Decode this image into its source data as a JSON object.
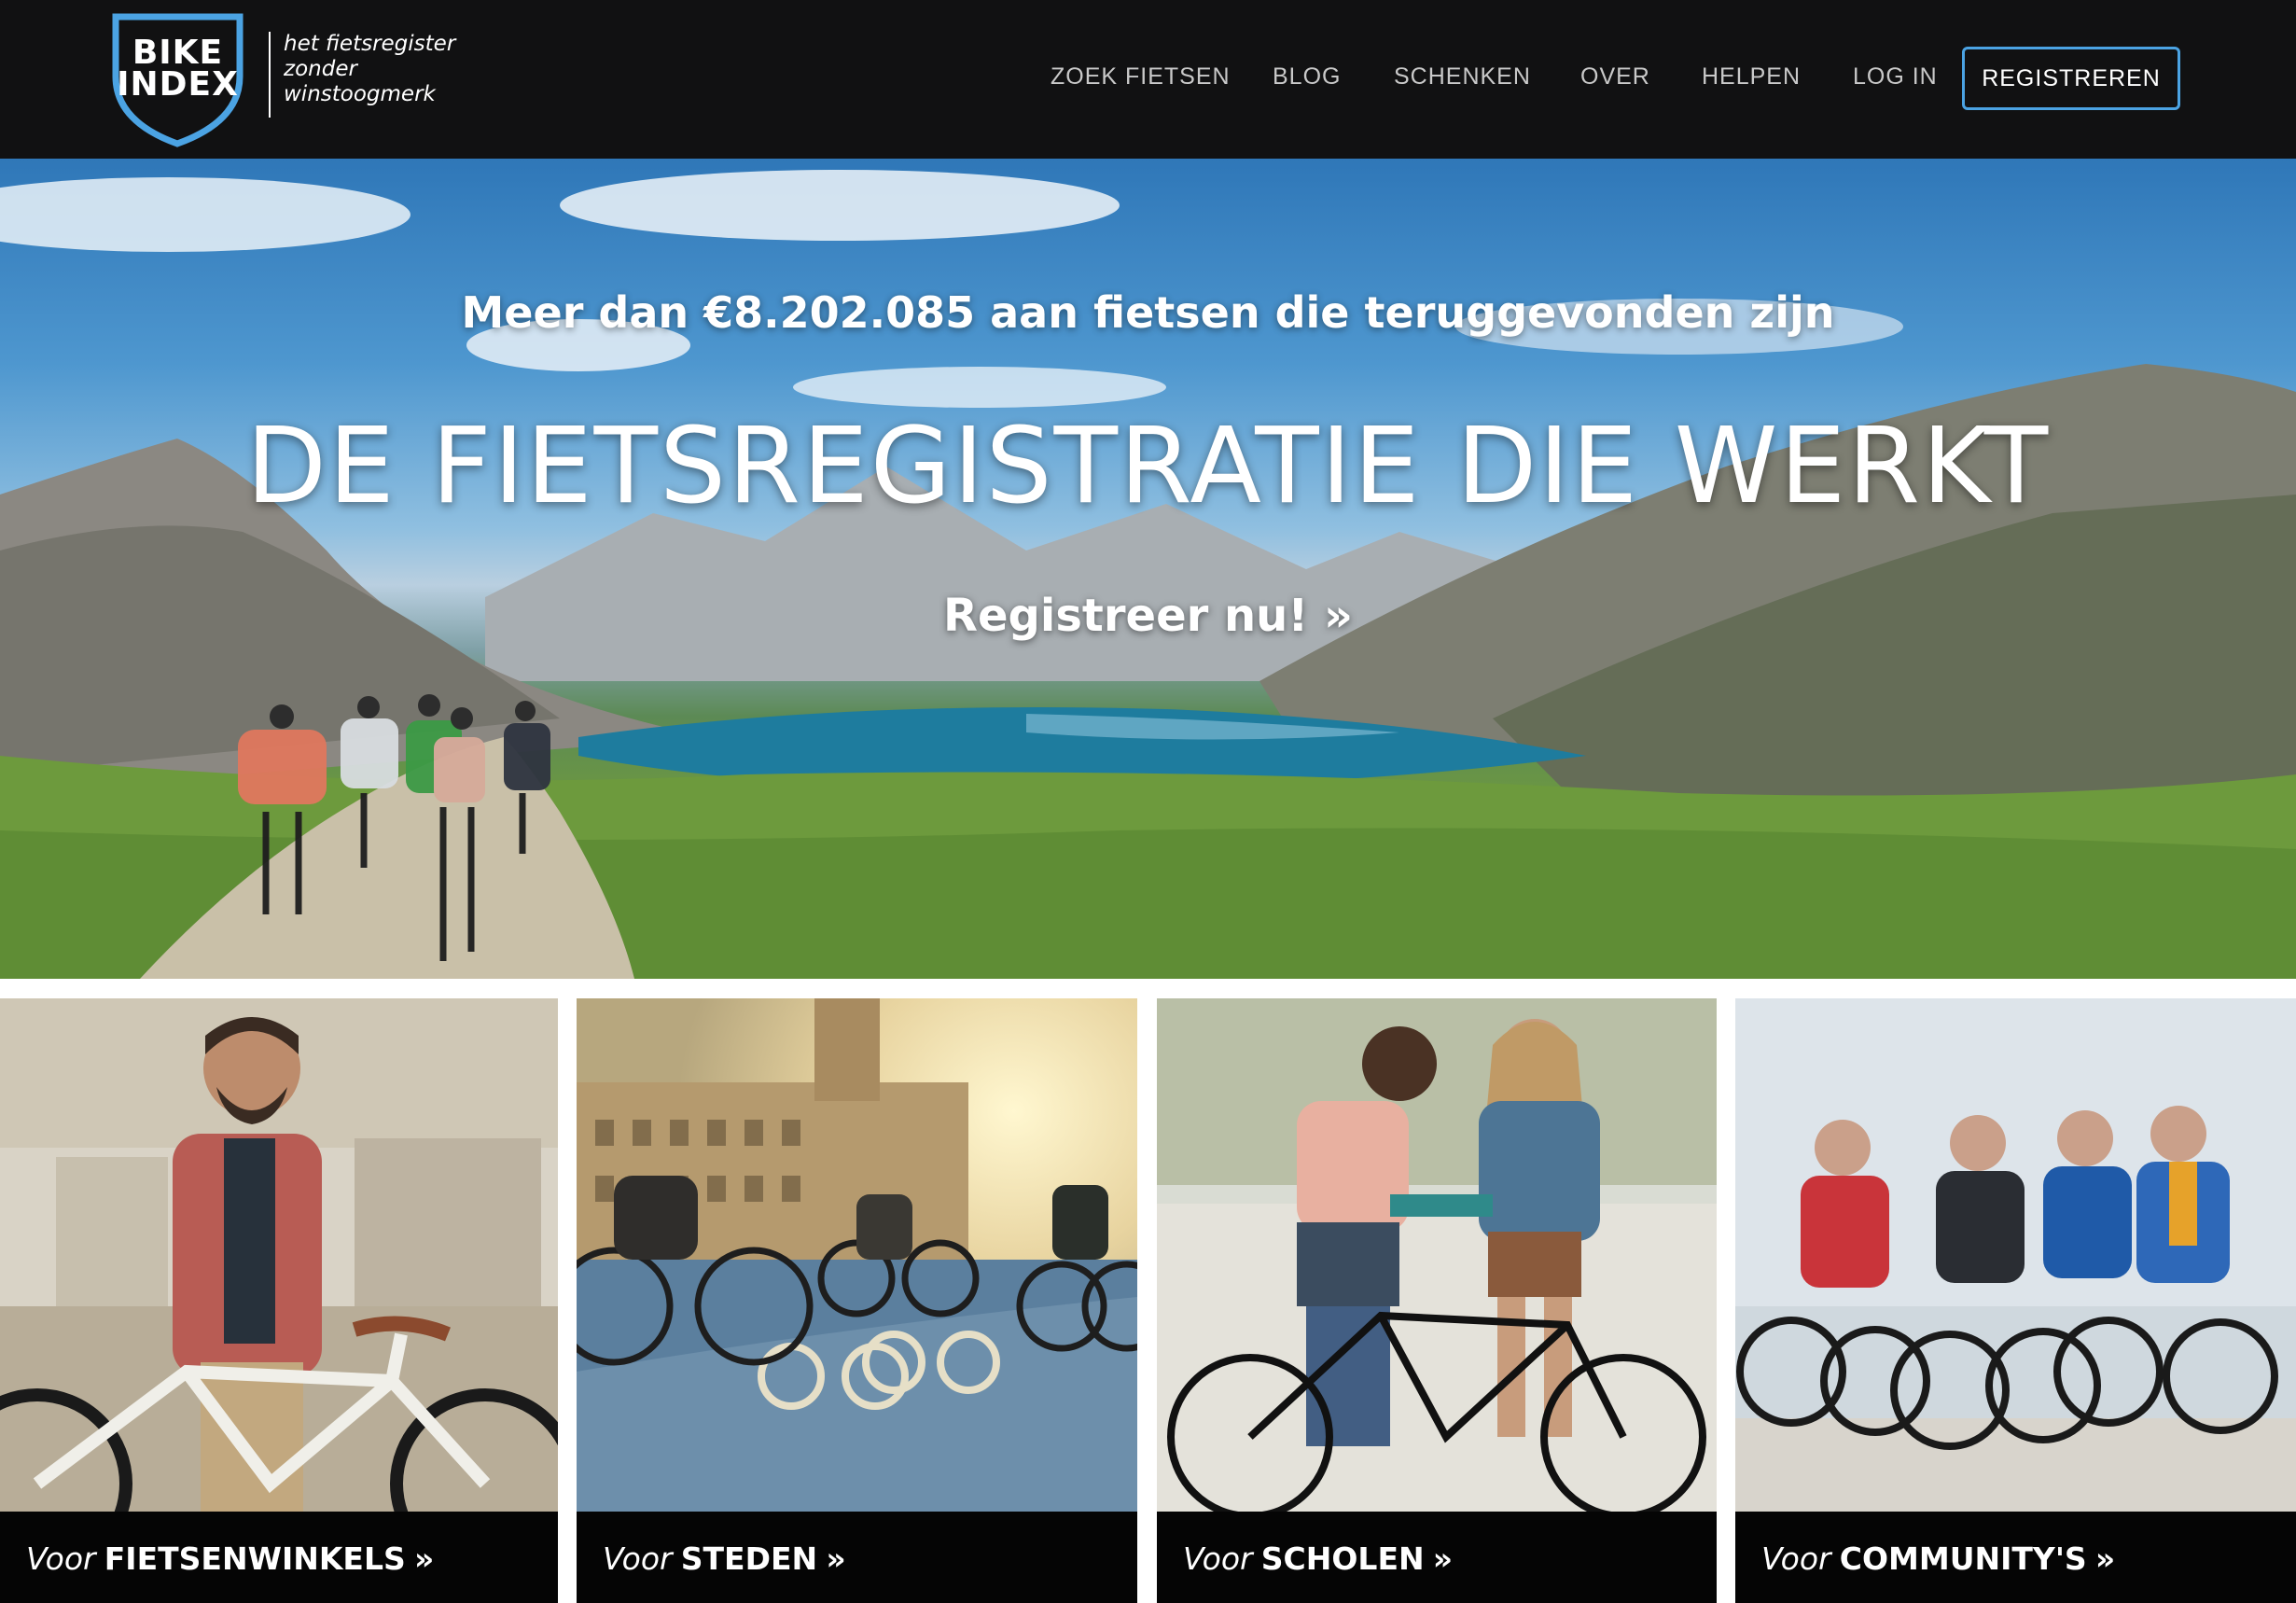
{
  "header": {
    "logo": {
      "line1": "BIKE",
      "line2": "INDEX",
      "tagline": [
        "het fietsregister",
        "zonder",
        "winstoogmerk"
      ]
    },
    "nav": [
      "ZOEK FIETSEN",
      "BLOG",
      "SCHENKEN",
      "OVER",
      "HELPEN",
      "LOG IN"
    ],
    "register_label": "REGISTREREN"
  },
  "hero": {
    "stat": "Meer dan €8.202.085 aan fietsen die teruggevonden zijn",
    "title": "DE FIETSREGISTRATIE DIE WERKT",
    "cta": "Registreer nu!",
    "cta_arrow": "»"
  },
  "cards": [
    {
      "prefix": "Voor",
      "label": "FIETSENWINKELS",
      "arrow": "»"
    },
    {
      "prefix": "Voor",
      "label": "STEDEN",
      "arrow": "»"
    },
    {
      "prefix": "Voor",
      "label": "SCHOLEN",
      "arrow": "»"
    },
    {
      "prefix": "Voor",
      "label": "COMMUNITY'S",
      "arrow": "»"
    }
  ],
  "colors": {
    "header_bg": "#111112",
    "accent": "#4ba3e3",
    "card_bar": "#050505"
  }
}
